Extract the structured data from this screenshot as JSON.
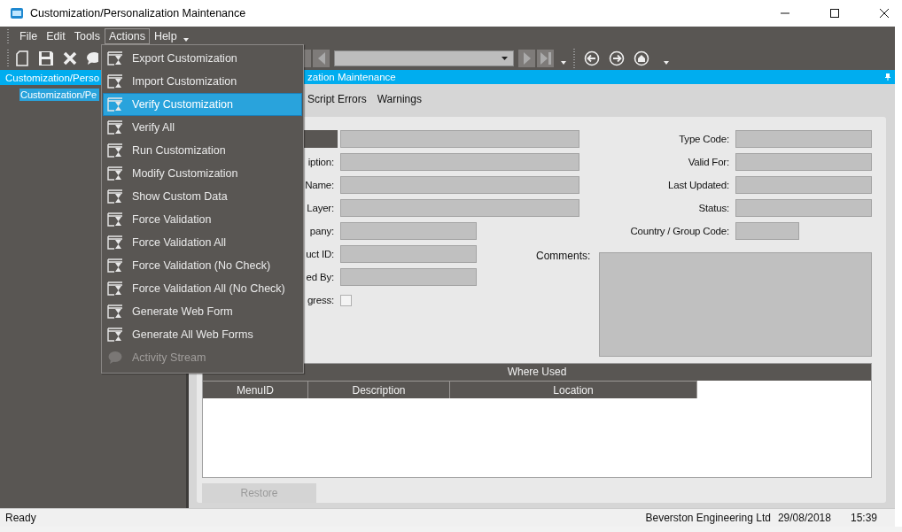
{
  "window": {
    "title": "Customization/Personalization Maintenance"
  },
  "menu_bar": [
    {
      "label": "File",
      "selected": false
    },
    {
      "label": "Edit",
      "selected": false
    },
    {
      "label": "Tools",
      "selected": false
    },
    {
      "label": "Actions",
      "selected": true
    },
    {
      "label": "Help",
      "selected": false
    }
  ],
  "navigator": {
    "header": "Customization/Perso",
    "tree": [
      {
        "label": "Customization/Pe",
        "selected": true
      }
    ]
  },
  "main": {
    "header": "zation Maintenance",
    "tabs": [
      {
        "label": "Script Errors"
      },
      {
        "label": "Warnings"
      }
    ]
  },
  "form": {
    "left_fields": [
      {
        "kind": "wide"
      },
      {
        "kind": "wide",
        "label": "iption:"
      },
      {
        "kind": "wide",
        "label": "Name:"
      },
      {
        "kind": "wide",
        "label": "Layer:"
      },
      {
        "kind": "narrow",
        "label": "pany:"
      },
      {
        "kind": "narrow",
        "label": "uct ID:"
      },
      {
        "kind": "narrow",
        "label": "ed By:"
      },
      {
        "kind": "checkbox",
        "label": "gress:",
        "checked": false
      }
    ],
    "right_fields": [
      {
        "kind": "narrow",
        "label": "Type Code:"
      },
      {
        "kind": "narrow",
        "label": "Valid For:"
      },
      {
        "kind": "narrow",
        "label": "Last Updated:"
      },
      {
        "kind": "narrow",
        "label": "Status:"
      },
      {
        "kind": "short",
        "label": "Country / Group Code:"
      }
    ],
    "comments_label": "Comments:"
  },
  "where_used": {
    "title": "Where Used",
    "columns": [
      "MenuID",
      "Description",
      "Location"
    ]
  },
  "restore_button": {
    "label": "Restore",
    "disabled": true
  },
  "status_bar": {
    "text": "Ready",
    "company": "Beverston Engineering Ltd",
    "date": "29/08/2018",
    "time": "15:39"
  },
  "actions_menu": [
    {
      "label": "Export Customization",
      "kind": "window",
      "selected": false,
      "disabled": false
    },
    {
      "label": "Import Customization",
      "kind": "window",
      "selected": false,
      "disabled": false
    },
    {
      "label": "Verify Customization",
      "kind": "window",
      "selected": true,
      "disabled": false
    },
    {
      "label": "Verify All",
      "kind": "window",
      "selected": false,
      "disabled": false
    },
    {
      "label": "Run Customization",
      "kind": "window",
      "selected": false,
      "disabled": false
    },
    {
      "label": "Modify Customization",
      "kind": "window",
      "selected": false,
      "disabled": false
    },
    {
      "label": "Show Custom Data",
      "kind": "window",
      "selected": false,
      "disabled": false
    },
    {
      "label": "Force Validation",
      "kind": "window",
      "selected": false,
      "disabled": false
    },
    {
      "label": "Force Validation All",
      "kind": "window",
      "selected": false,
      "disabled": false
    },
    {
      "label": "Force Validation (No Check)",
      "kind": "window",
      "selected": false,
      "disabled": false
    },
    {
      "label": "Force Validation All (No Check)",
      "kind": "window",
      "selected": false,
      "disabled": false
    },
    {
      "label": "Generate Web Form",
      "kind": "window",
      "selected": false,
      "disabled": false
    },
    {
      "label": "Generate All Web Forms",
      "kind": "window",
      "selected": false,
      "disabled": false
    },
    {
      "label": "Activity Stream",
      "kind": "bubble",
      "selected": false,
      "disabled": true
    }
  ]
}
